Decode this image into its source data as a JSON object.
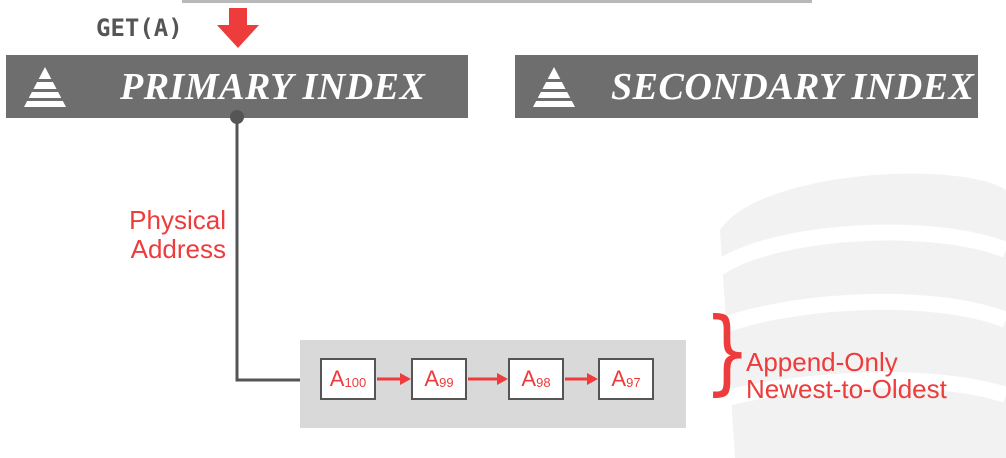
{
  "command": "GET(A)",
  "primary_index": {
    "title": "PRIMARY INDEX",
    "icon": "pyramid-icon"
  },
  "secondary_index": {
    "title": "SECONDARY INDEX",
    "icon": "pyramid-icon"
  },
  "pointer_label": {
    "line1": "Physical",
    "line2": "Address"
  },
  "versions": [
    {
      "base": "A",
      "sub": "100"
    },
    {
      "base": "A",
      "sub": "99"
    },
    {
      "base": "A",
      "sub": "98"
    },
    {
      "base": "A",
      "sub": "97"
    }
  ],
  "chain_label": {
    "line1": "Append-Only",
    "line2": "Newest-to-Oldest"
  },
  "colors": {
    "accent": "#ee3b3b",
    "box": "#6e6e6e",
    "chain_bg": "#d9d9d9",
    "line": "#555555"
  }
}
